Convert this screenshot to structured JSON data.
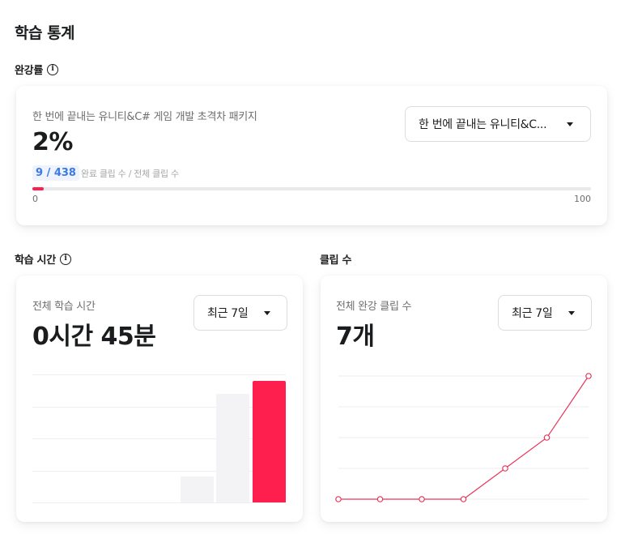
{
  "page": {
    "title": "학습 통계"
  },
  "completion": {
    "section_label": "완강률",
    "course_name": "한 번에 끝내는 유니티&C# 게임 개발 초격차 패키지",
    "percent_text": "2%",
    "ratio_text": "9 / 438",
    "ratio_caption": "완료 클립 수 / 전체 클립 수",
    "completed_clips": 9,
    "total_clips": 438,
    "axis_min": "0",
    "axis_max": "100",
    "dropdown_value": "한 번에 끝내는 유니티&C..."
  },
  "study_time": {
    "section_label": "학습 시간",
    "caption": "전체 학습 시간",
    "value_text": "0시간 45분",
    "dropdown_value": "최근 7일",
    "chart_data": {
      "type": "bar",
      "categories": [
        "",
        "",
        "",
        "",
        "",
        "",
        ""
      ],
      "values": [
        0,
        0,
        0,
        0,
        8,
        34,
        38
      ],
      "highlight_index": 6,
      "colors": {
        "default": "#f3f3f5",
        "highlight": "#ff1f4e",
        "grid": "#eceef0"
      },
      "ylim": [
        0,
        40
      ],
      "grid": true
    }
  },
  "clips": {
    "section_label": "클립 수",
    "caption": "전체 완강 클립 수",
    "value_text": "7개",
    "dropdown_value": "최근 7일",
    "chart_data": {
      "type": "line",
      "x": [
        1,
        2,
        3,
        4,
        5,
        6,
        7
      ],
      "values": [
        0,
        0,
        0,
        0,
        1,
        2,
        4
      ],
      "colors": {
        "line": "#e8365a",
        "marker_fill": "#ffffff",
        "grid": "#eceef0"
      },
      "ylim": [
        0,
        4
      ],
      "grid": true
    }
  }
}
